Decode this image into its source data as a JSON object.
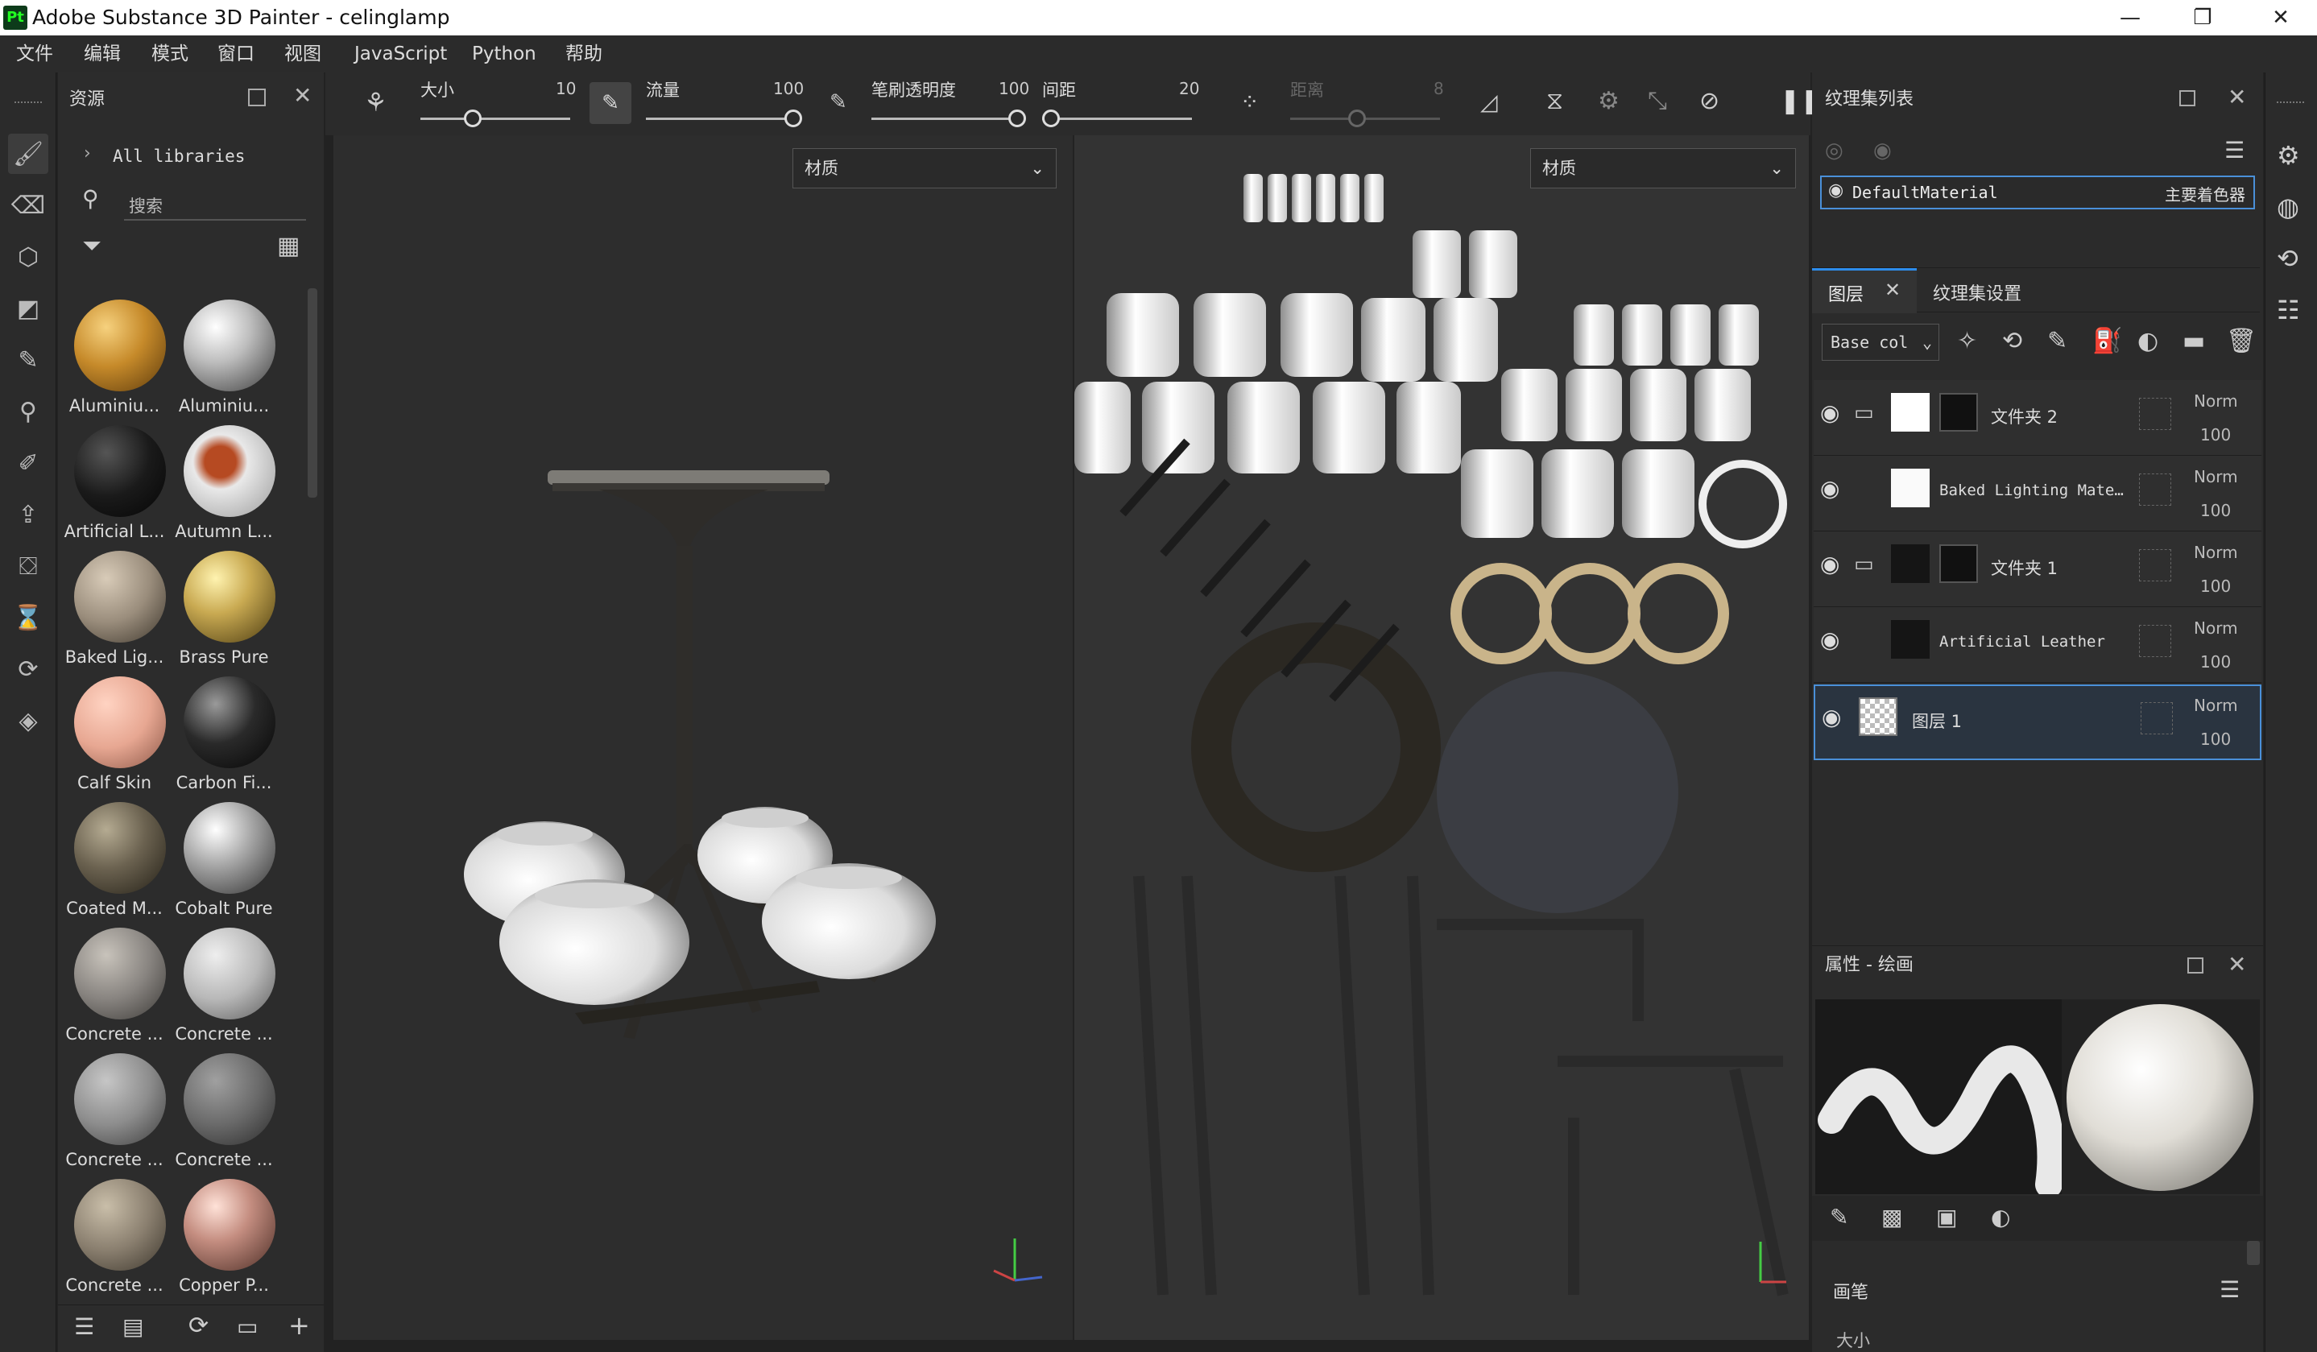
{
  "window": {
    "app_icon": "Pt",
    "title": "Adobe Substance 3D Painter - celinglamp",
    "minimize": "—",
    "restore": "❐",
    "close": "✕"
  },
  "menu": [
    "文件",
    "编辑",
    "模式",
    "窗口",
    "视图",
    "JavaScript",
    "Python",
    "帮助"
  ],
  "assets": {
    "title": "资源",
    "all_libraries": "All libraries",
    "search_placeholder": "搜索",
    "materials": [
      {
        "label": "Aluminiu...",
        "color": "#c68a2a"
      },
      {
        "label": "Aluminiu...",
        "color": "#bdbdbd"
      },
      {
        "label": "Artificial L...",
        "color": "#1a1a1a"
      },
      {
        "label": "Autumn L...",
        "color": "#c9c9c9"
      },
      {
        "label": "Baked Lig...",
        "color": "#9a8d7c"
      },
      {
        "label": "Brass Pure",
        "color": "#c9aa52"
      },
      {
        "label": "Calf Skin",
        "color": "#e7a792"
      },
      {
        "label": "Carbon Fi...",
        "color": "#2a2a2a"
      },
      {
        "label": "Coated M...",
        "color": "#6b6250"
      },
      {
        "label": "Cobalt Pure",
        "color": "#a9a9a9"
      },
      {
        "label": "Concrete ...",
        "color": "#888480"
      },
      {
        "label": "Concrete ...",
        "color": "#b8b8b8"
      },
      {
        "label": "Concrete ...",
        "color": "#8d8d8d"
      },
      {
        "label": "Concrete ...",
        "color": "#6a6a6a"
      },
      {
        "label": "Concrete ...",
        "color": "#8a7f6f"
      },
      {
        "label": "Copper P...",
        "color": "#c48d80"
      }
    ]
  },
  "toolbar": {
    "size_label": "大小",
    "size_value": "10",
    "flow_label": "流量",
    "flow_value": "100",
    "opacity_label": "笔刷透明度",
    "opacity_value": "100",
    "spacing_label": "间距",
    "spacing_value": "20",
    "distance_label": "距离",
    "distance_value": "8"
  },
  "viewport3d": {
    "dropdown": "材质"
  },
  "viewport2d": {
    "dropdown": "材质"
  },
  "texture_sets": {
    "title": "纹理集列表",
    "item_name": "DefaultMaterial",
    "item_shader": "主要着色器"
  },
  "layers": {
    "tab_layers": "图层",
    "tab_settings": "纹理集设置",
    "channel": "Base col",
    "items": [
      {
        "name": "文件夹 2",
        "blend": "Norm",
        "opacity": "100"
      },
      {
        "name": "Baked Lighting Mate…",
        "blend": "Norm",
        "opacity": "100"
      },
      {
        "name": "文件夹 1",
        "blend": "Norm",
        "opacity": "100"
      },
      {
        "name": "Artificial Leather",
        "blend": "Norm",
        "opacity": "100"
      },
      {
        "name": "图层 1",
        "blend": "Norm",
        "opacity": "100"
      }
    ]
  },
  "properties": {
    "title": "属性 - 绘画",
    "section": "画笔",
    "size_label": "大小"
  },
  "colors": {
    "accent": "#2d8ceb",
    "selection": "#4a90d9"
  }
}
